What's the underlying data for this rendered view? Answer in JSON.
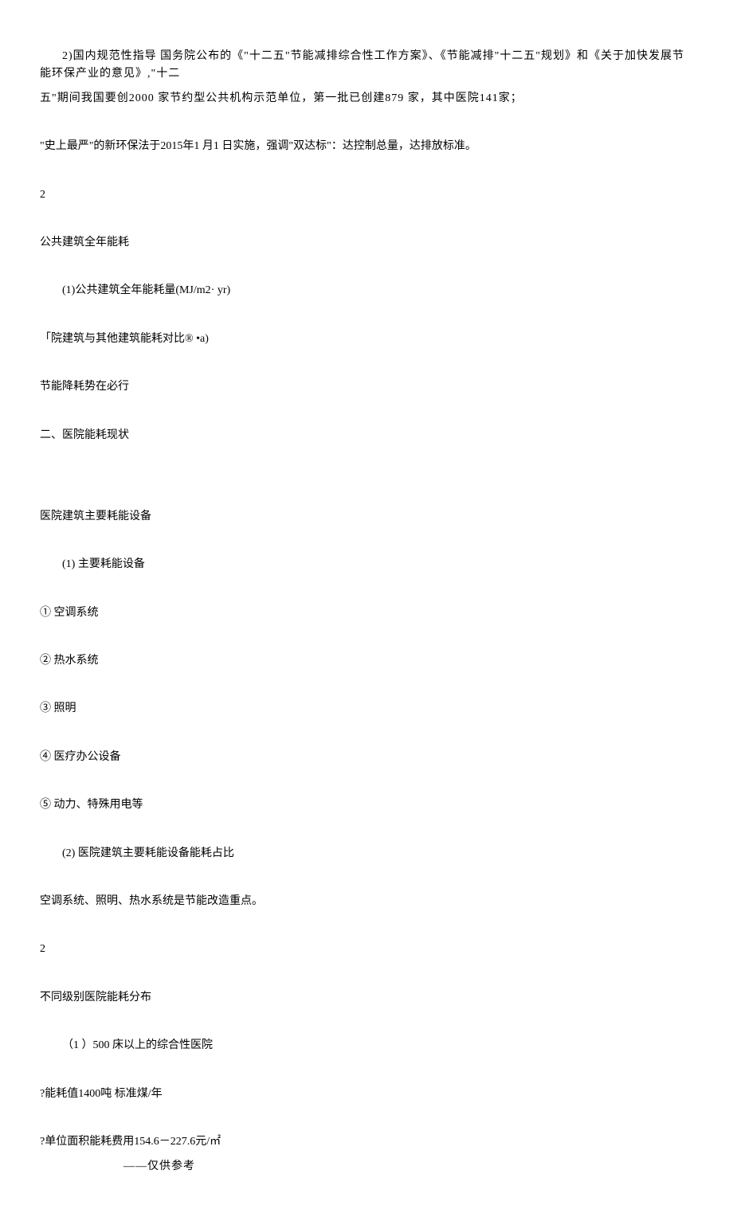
{
  "p1": "2)国内规范性指导 国务院公布的《\"十二五\"节能减排综合性工作方案》、《节能减排\"十二五\"规划》和《关于加快发展节能环保产业的意见》,\"十二",
  "p2": "五\"期间我国要创2000 家节约型公共机构示范单位，第一批已创建879 家，其中医院141家；",
  "p3": "\"史上最严\"的新环保法于2015年1 月1 日实施，强调\"双达标\"：达控制总量，达排放标准。",
  "p4": "2",
  "p5": "公共建筑全年能耗",
  "p6": "(1)公共建筑全年能耗量(MJ/m2· yr)",
  "p7": "「院建筑与其他建筑能耗对比® •a)",
  "p8": "节能降耗势在必行",
  "p9": "二、医院能耗现状",
  "p10": "医院建筑主要耗能设备",
  "p11": "(1)  主要耗能设备",
  "p12": "①  空调系统",
  "p13": "②  热水系统",
  "p14": "③  照明",
  "p15": "④  医疗办公设备",
  "p16": "⑤  动力、特殊用电等",
  "p17": "(2)  医院建筑主要耗能设备能耗占比",
  "p18": "空调系统、照明、热水系统是节能改造重点。",
  "p19": "2",
  "p20": "不同级别医院能耗分布",
  "p21": "（1 ）500 床以上的综合性医院",
  "p22": "?能耗值1400吨 标准煤/年",
  "p23": "?单位面积能耗费用154.6－227.6元/㎡",
  "footer": "——仅供参考"
}
